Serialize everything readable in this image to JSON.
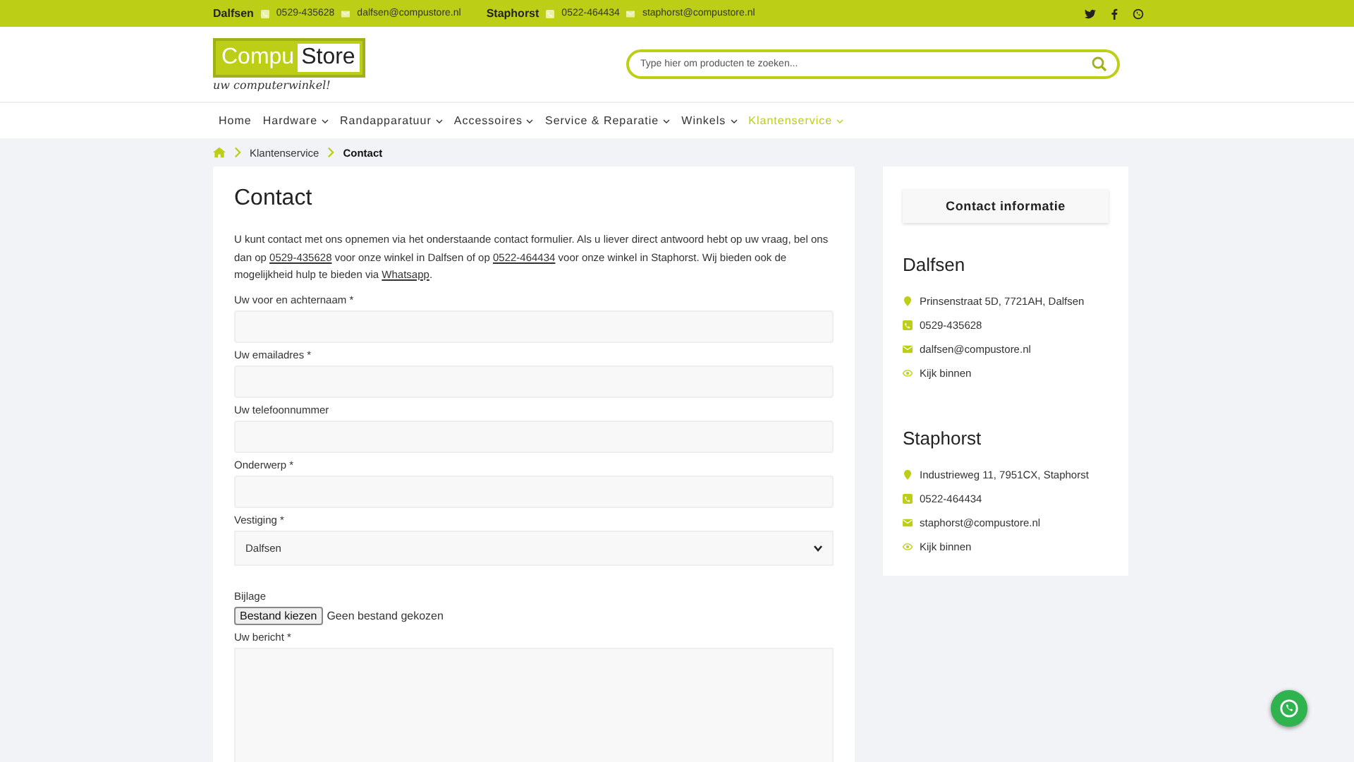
{
  "topbar": {
    "stores": [
      {
        "name": "Dalfsen",
        "phone": "0529-435628",
        "email": "dalfsen@compustore.nl"
      },
      {
        "name": "Staphorst",
        "phone": "0522-464434",
        "email": "staphorst@compustore.nl"
      }
    ]
  },
  "logo": {
    "part1": "Compu",
    "part2": "Store",
    "tagline": "uw computerwinkel!"
  },
  "search": {
    "placeholder": "Type hier om producten te zoeken..."
  },
  "nav": [
    {
      "label": "Home",
      "dropdown": false,
      "selected": false
    },
    {
      "label": "Hardware",
      "dropdown": true,
      "selected": false
    },
    {
      "label": "Randapparatuur",
      "dropdown": true,
      "selected": false
    },
    {
      "label": "Accessoires",
      "dropdown": true,
      "selected": false
    },
    {
      "label": "Service & Reparatie",
      "dropdown": true,
      "selected": false
    },
    {
      "label": "Winkels",
      "dropdown": true,
      "selected": false
    },
    {
      "label": "Klantenservice",
      "dropdown": true,
      "selected": true
    }
  ],
  "breadcrumb": [
    "Klantenservice",
    "Contact"
  ],
  "content": {
    "title": "Contact",
    "intro": [
      {
        "kind": "text",
        "text": "U kunt contact met ons opnemen via het onderstaande contact formulier. Als u liever direct antwoord hebt op uw vraag, bel ons dan op "
      },
      {
        "kind": "link",
        "text": "0529-435628"
      },
      {
        "kind": "text",
        "text": " voor onze winkel in Dalfsen of op "
      },
      {
        "kind": "link",
        "text": "0522-464434"
      },
      {
        "kind": "text",
        "text": " voor onze winkel in Staphorst. Wij bieden ook de mogelijkheid hulp te bieden via "
      },
      {
        "kind": "link",
        "text": "Whatsapp"
      },
      {
        "kind": "text",
        "text": "."
      }
    ],
    "fields": [
      {
        "kind": "text",
        "label": "Uw voor en achternaam *"
      },
      {
        "kind": "text",
        "label": "Uw emailadres *"
      },
      {
        "kind": "text",
        "label": "Uw telefoonnummer"
      },
      {
        "kind": "text",
        "label": "Onderwerp *"
      },
      {
        "kind": "select",
        "label": "Vestiging *",
        "value": "Dalfsen"
      },
      {
        "kind": "file",
        "label": "Bijlage",
        "button": "Bestand kiezen",
        "status": "Geen bestand gekozen"
      },
      {
        "kind": "textarea",
        "label": "Uw bericht *"
      }
    ]
  },
  "sidebar": {
    "heading": "Contact informatie",
    "stores": [
      {
        "name": "Dalfsen",
        "address": "Prinsenstraat 5D, 7721AH, Dalfsen",
        "phone": "0529-435628",
        "email": "dalfsen@compustore.nl",
        "link": "Kijk binnen"
      },
      {
        "name": "Staphorst",
        "address": "Industrieweg 11, 7951CX, Staphorst",
        "phone": "0522-464434",
        "email": "staphorst@compustore.nl",
        "link": "Kijk binnen"
      }
    ]
  }
}
